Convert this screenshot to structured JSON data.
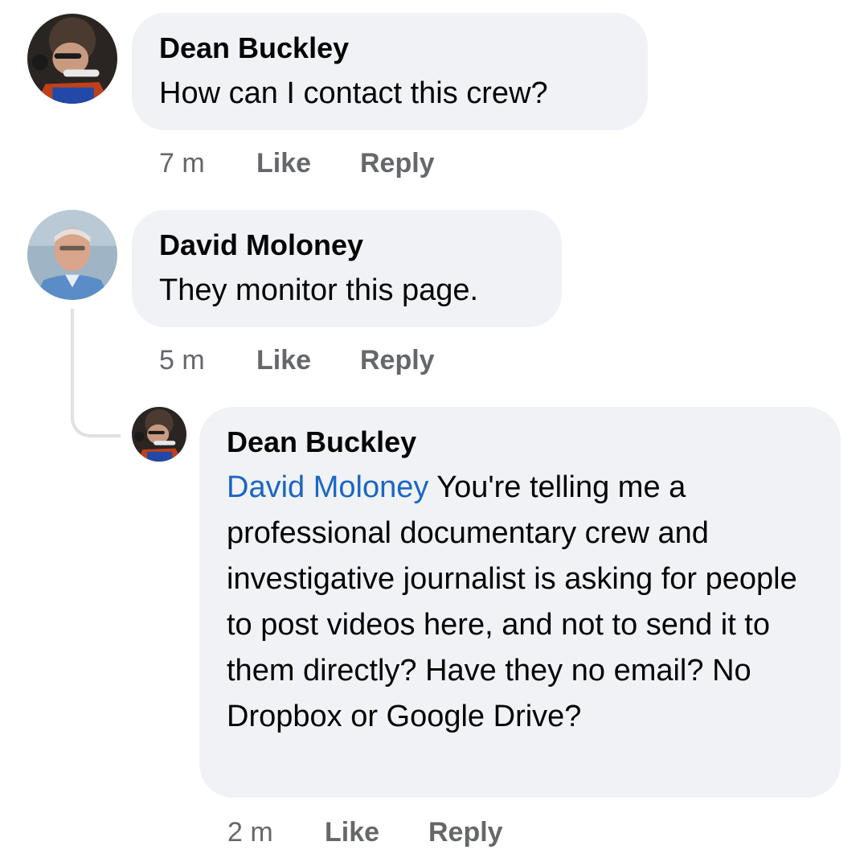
{
  "comments": [
    {
      "author": "Dean Buckley",
      "text": "How can I contact this crew?",
      "time": "7 m",
      "like_label": "Like",
      "reply_label": "Reply"
    },
    {
      "author": "David Moloney",
      "text": "They monitor this page.",
      "time": "5 m",
      "like_label": "Like",
      "reply_label": "Reply"
    },
    {
      "author": "Dean Buckley",
      "mention": "David Moloney",
      "text": " You're telling me a professional documentary crew and investigative journalist is asking for people to post videos here, and not to send it to them directly? Have they no email? No Dropbox or Google Drive?",
      "time": "2 m",
      "like_label": "Like",
      "reply_label": "Reply"
    }
  ],
  "colors": {
    "bubble": "#f0f2f5",
    "mention": "#1b66c2",
    "meta": "#65676b",
    "thread_line": "#dfe1e5"
  }
}
